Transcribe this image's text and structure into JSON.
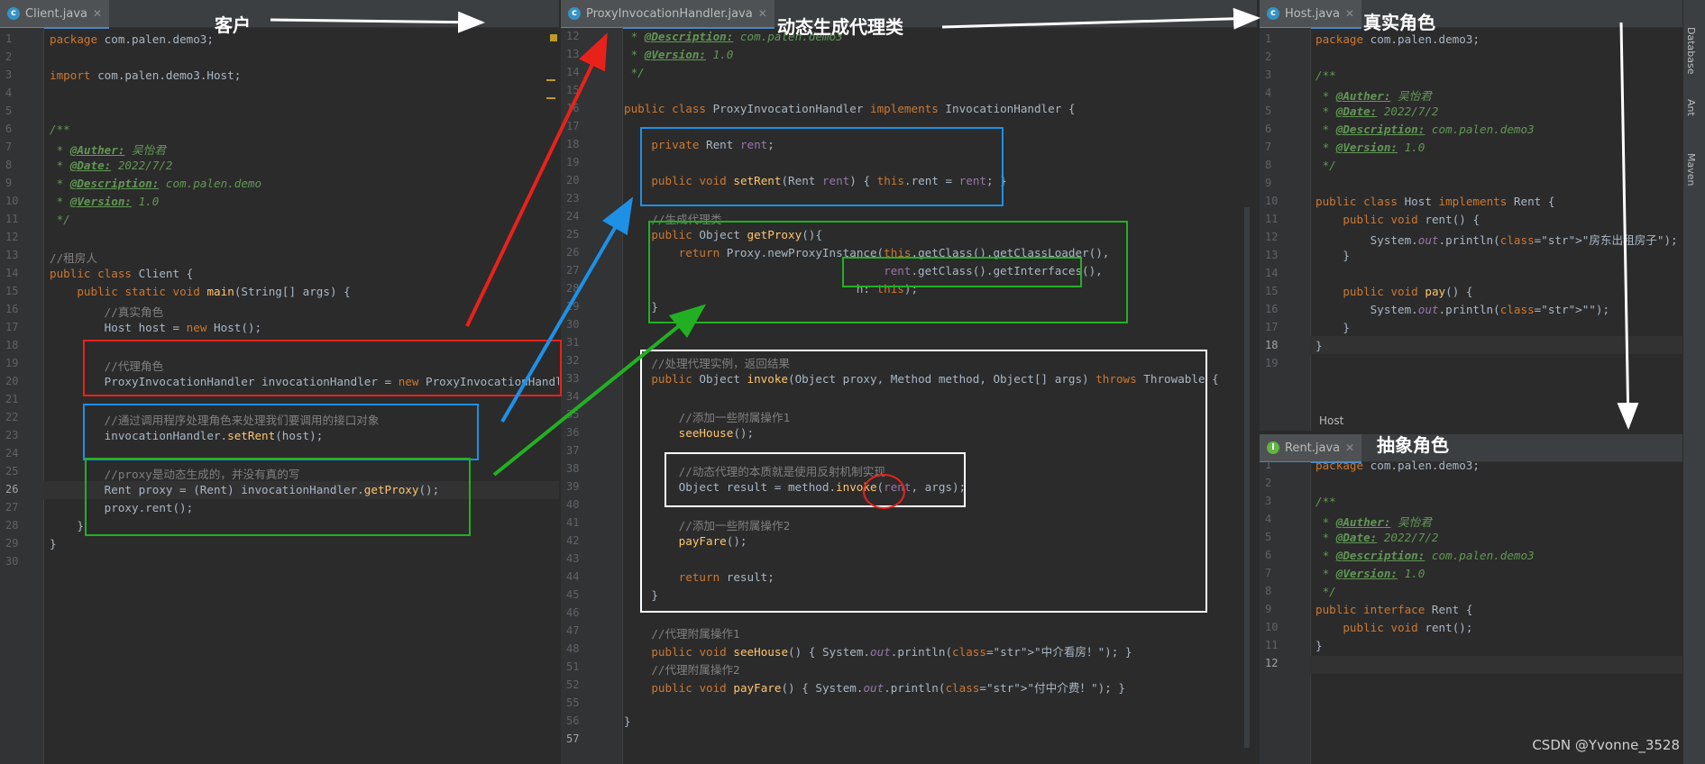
{
  "annotations": {
    "client": "客户",
    "proxy_gen": "动态生成代理类",
    "real_role": "真实角色",
    "abstract_role": "抽象角色"
  },
  "left_pane": {
    "tab": "Client.java",
    "lines": [
      {
        "n": "1",
        "t": "package com.palen.demo3;"
      },
      {
        "n": "2",
        "t": ""
      },
      {
        "n": "3",
        "t": "import com.palen.demo3.Host;"
      },
      {
        "n": "4",
        "t": ""
      },
      {
        "n": "5",
        "t": ""
      },
      {
        "n": "6",
        "t": "/**"
      },
      {
        "n": "7",
        "t": " * @Auther: 吴怡君"
      },
      {
        "n": "8",
        "t": " * @Date: 2022/7/2"
      },
      {
        "n": "9",
        "t": " * @Description: com.palen.demo"
      },
      {
        "n": "10",
        "t": " * @Version: 1.0"
      },
      {
        "n": "11",
        "t": " */"
      },
      {
        "n": "12",
        "t": ""
      },
      {
        "n": "13",
        "t": "//租房人"
      },
      {
        "n": "14",
        "t": "public class Client {"
      },
      {
        "n": "15",
        "t": "    public static void main(String[] args) {"
      },
      {
        "n": "16",
        "t": "        //真实角色"
      },
      {
        "n": "17",
        "t": "        Host host = new Host();"
      },
      {
        "n": "18",
        "t": ""
      },
      {
        "n": "19",
        "t": "        //代理角色"
      },
      {
        "n": "20",
        "t": "        ProxyInvocationHandler invocationHandler = new ProxyInvocationHandler();"
      },
      {
        "n": "21",
        "t": ""
      },
      {
        "n": "22",
        "t": "        //通过调用程序处理角色来处理我们要调用的接口对象"
      },
      {
        "n": "23",
        "t": "        invocationHandler.setRent(host);"
      },
      {
        "n": "24",
        "t": ""
      },
      {
        "n": "25",
        "t": "        //proxy是动态生成的，并没有真的写"
      },
      {
        "n": "26",
        "t": "        Rent proxy = (Rent) invocationHandler.getProxy();"
      },
      {
        "n": "27",
        "t": "        proxy.rent();"
      },
      {
        "n": "28",
        "t": "    }"
      },
      {
        "n": "29",
        "t": "}"
      },
      {
        "n": "30",
        "t": ""
      }
    ]
  },
  "middle_pane": {
    "tab": "ProxyInvocationHandler.java",
    "lines": [
      {
        "n": "12",
        "t": " * @Description: com.palen.demo3"
      },
      {
        "n": "13",
        "t": " * @Version: 1.0"
      },
      {
        "n": "14",
        "t": " */"
      },
      {
        "n": "15",
        "t": ""
      },
      {
        "n": "16",
        "t": "public class ProxyInvocationHandler implements InvocationHandler {"
      },
      {
        "n": "17",
        "t": ""
      },
      {
        "n": "18",
        "t": "    private Rent rent;"
      },
      {
        "n": "19",
        "t": ""
      },
      {
        "n": "20",
        "t": "    public void setRent(Rent rent) { this.rent = rent; }"
      },
      {
        "n": "23",
        "t": ""
      },
      {
        "n": "24",
        "t": "    //生成代理类"
      },
      {
        "n": "25",
        "t": "    public Object getProxy(){"
      },
      {
        "n": "26",
        "t": "        return Proxy.newProxyInstance(this.getClass().getClassLoader(),"
      },
      {
        "n": "27",
        "t": "                                      rent.getClass().getInterfaces(),"
      },
      {
        "n": "28",
        "t": "                                  h: this);"
      },
      {
        "n": "29",
        "t": "    }"
      },
      {
        "n": "30",
        "t": ""
      },
      {
        "n": "31",
        "t": ""
      },
      {
        "n": "32",
        "t": "    //处理代理实例，返回结果"
      },
      {
        "n": "33",
        "t": "    public Object invoke(Object proxy, Method method, Object[] args) throws Throwable {"
      },
      {
        "n": "34",
        "t": ""
      },
      {
        "n": "35",
        "t": "        //添加一些附属操作1"
      },
      {
        "n": "36",
        "t": "        seeHouse();"
      },
      {
        "n": "37",
        "t": ""
      },
      {
        "n": "38",
        "t": "        //动态代理的本质就是使用反射机制实现"
      },
      {
        "n": "39",
        "t": "        Object result = method.invoke(rent, args);"
      },
      {
        "n": "40",
        "t": ""
      },
      {
        "n": "41",
        "t": "        //添加一些附属操作2"
      },
      {
        "n": "42",
        "t": "        payFare();"
      },
      {
        "n": "43",
        "t": ""
      },
      {
        "n": "44",
        "t": "        return result;"
      },
      {
        "n": "45",
        "t": "    }"
      },
      {
        "n": "46",
        "t": ""
      },
      {
        "n": "47",
        "t": "    //代理附属操作1"
      },
      {
        "n": "48",
        "t": "    public void seeHouse() { System.out.println(\"中介看房！\"); }"
      },
      {
        "n": "51",
        "t": "    //代理附属操作2"
      },
      {
        "n": "52",
        "t": "    public void payFare() { System.out.println(\"付中介费！\"); }"
      },
      {
        "n": "55",
        "t": ""
      },
      {
        "n": "56",
        "t": "}"
      },
      {
        "n": "57",
        "t": ""
      }
    ]
  },
  "host_pane": {
    "tab": "Host.java",
    "lines": [
      {
        "n": "1",
        "t": "package com.palen.demo3;"
      },
      {
        "n": "2",
        "t": ""
      },
      {
        "n": "3",
        "t": "/**"
      },
      {
        "n": "4",
        "t": " * @Auther: 吴怡君"
      },
      {
        "n": "5",
        "t": " * @Date: 2022/7/2"
      },
      {
        "n": "6",
        "t": " * @Description: com.palen.demo3"
      },
      {
        "n": "7",
        "t": " * @Version: 1.0"
      },
      {
        "n": "8",
        "t": " */"
      },
      {
        "n": "9",
        "t": ""
      },
      {
        "n": "10",
        "t": "public class Host implements Rent {"
      },
      {
        "n": "11",
        "t": "    public void rent() {"
      },
      {
        "n": "12",
        "t": "        System.out.println(\"房东出租房子\");"
      },
      {
        "n": "13",
        "t": "    }"
      },
      {
        "n": "14",
        "t": ""
      },
      {
        "n": "15",
        "t": "    public void pay() {"
      },
      {
        "n": "16",
        "t": "        System.out.println(\"\");"
      },
      {
        "n": "17",
        "t": "    }"
      },
      {
        "n": "18",
        "t": "}"
      },
      {
        "n": "19",
        "t": ""
      }
    ],
    "breadcrumb": "Host"
  },
  "rent_pane": {
    "tab": "Rent.java",
    "lines": [
      {
        "n": "1",
        "t": "package com.palen.demo3;"
      },
      {
        "n": "2",
        "t": ""
      },
      {
        "n": "3",
        "t": "/**"
      },
      {
        "n": "4",
        "t": " * @Auther: 吴怡君"
      },
      {
        "n": "5",
        "t": " * @Date: 2022/7/2"
      },
      {
        "n": "6",
        "t": " * @Description: com.palen.demo3"
      },
      {
        "n": "7",
        "t": " * @Version: 1.0"
      },
      {
        "n": "8",
        "t": " */"
      },
      {
        "n": "9",
        "t": "public interface Rent {"
      },
      {
        "n": "10",
        "t": "    public void rent();"
      },
      {
        "n": "11",
        "t": "}"
      },
      {
        "n": "12",
        "t": ""
      }
    ]
  },
  "sidebar": {
    "database": "Database",
    "ant": "Ant",
    "maven": "Maven"
  },
  "watermark": "CSDN @Yvonne_3528",
  "colors": {
    "red": "#e8221b",
    "blue": "#1e90e6",
    "green": "#22b022",
    "white": "#ffffff"
  }
}
